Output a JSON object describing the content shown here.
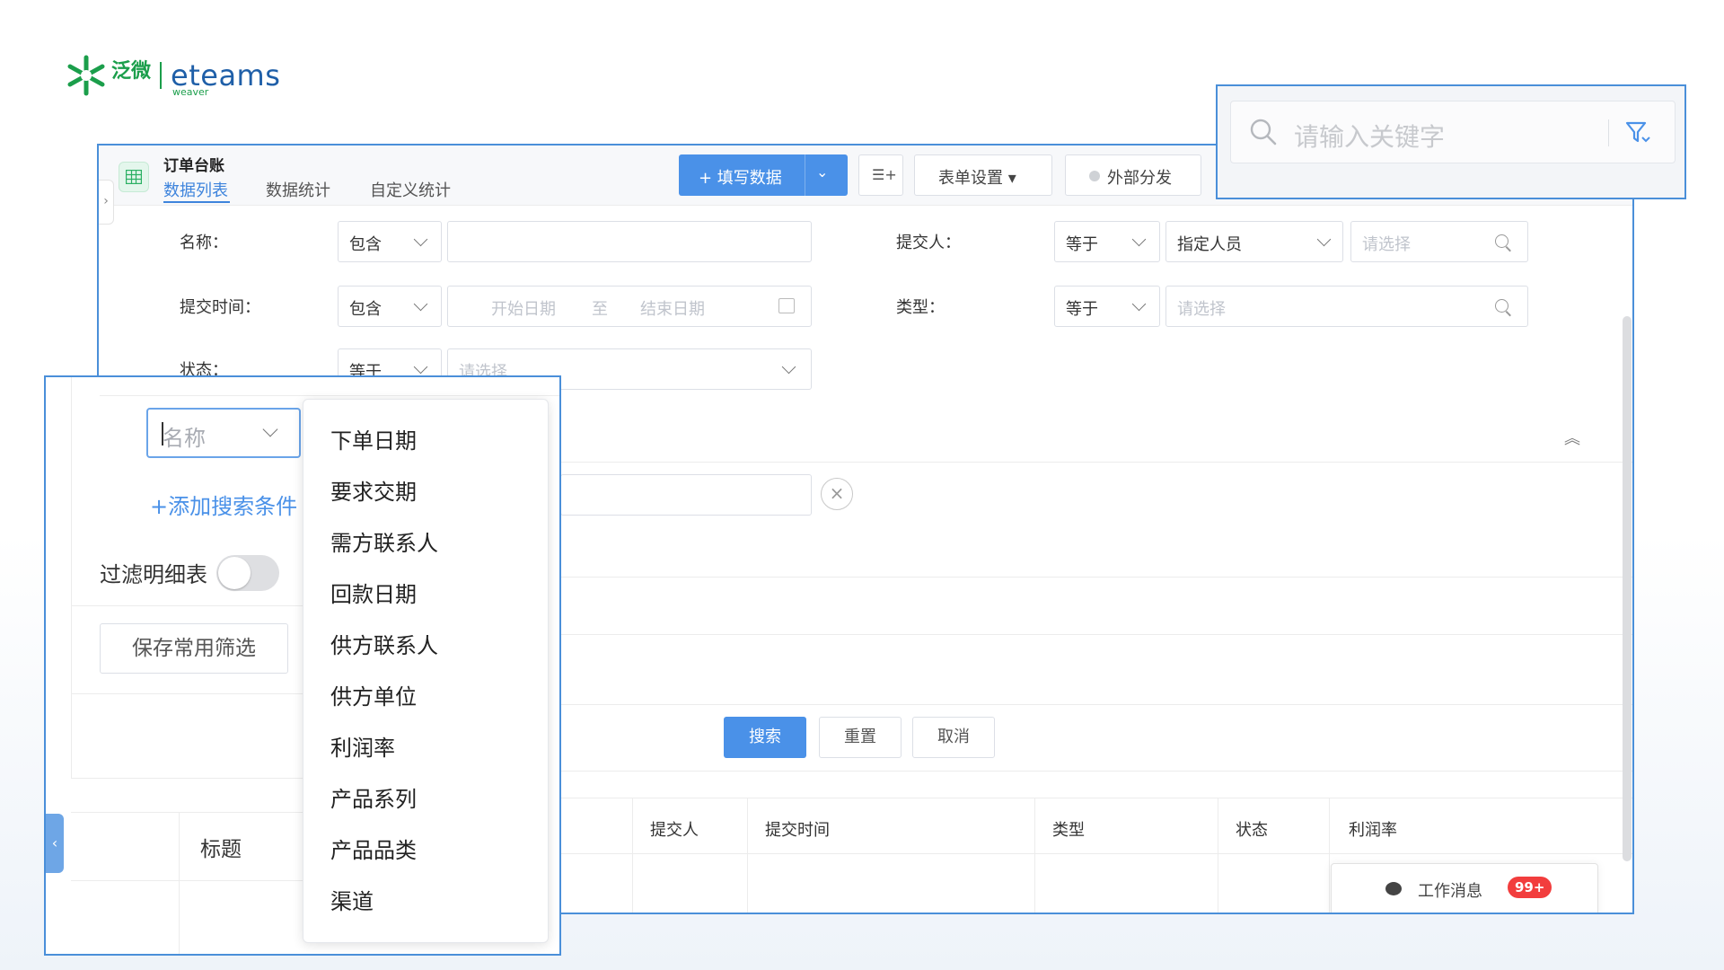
{
  "logo": {
    "cn": "泛微",
    "cn_sub": "weaver",
    "en": "eteams"
  },
  "app": {
    "title": "订单台账",
    "tabs": [
      {
        "label": "数据列表",
        "active": true
      },
      {
        "label": "数据统计",
        "active": false
      },
      {
        "label": "自定义统计",
        "active": false
      }
    ]
  },
  "toolbar": {
    "fill_label": "+ 填写数据",
    "form_settings": "表单设置 ▾",
    "external": "外部分发"
  },
  "filters": {
    "name_label": "名称：",
    "name_op": "包含",
    "submitter_label": "提交人：",
    "submitter_op": "等于",
    "submitter_mode": "指定人员",
    "submitter_ph": "请选择",
    "time_label": "提交时间：",
    "time_op": "包含",
    "start_ph": "开始日期",
    "to": "至",
    "end_ph": "结束日期",
    "type_label": "类型：",
    "type_op": "等于",
    "type_ph": "请选择",
    "status_label": "状态：",
    "status_op": "等于",
    "status_ph": "请选择"
  },
  "actions": {
    "search": "搜索",
    "reset": "重置",
    "cancel": "取消"
  },
  "table": {
    "headers": [
      "提交人",
      "提交时间",
      "类型",
      "状态",
      "利润率"
    ]
  },
  "messages": {
    "label": "工作消息",
    "badge": "99+"
  },
  "search_popup": {
    "placeholder": "请输入关键字"
  },
  "left_popup": {
    "field_placeholder": "名称",
    "add_condition": "+添加搜索条件",
    "filter_detail": "过滤明细表",
    "filter_detail_on": false,
    "save_filter": "保存常用筛选",
    "title_header": "标题",
    "dropdown_items": [
      "下单日期",
      "要求交期",
      "需方联系人",
      "回款日期",
      "供方联系人",
      "供方单位",
      "利润率",
      "产品系列",
      "产品品类",
      "渠道"
    ]
  },
  "colors": {
    "accent": "#4a91e8",
    "border_highlight": "#4a8fd9",
    "brand_green": "#1b9e4b",
    "brand_blue": "#1f5fa8",
    "badge": "#f23d3d"
  }
}
